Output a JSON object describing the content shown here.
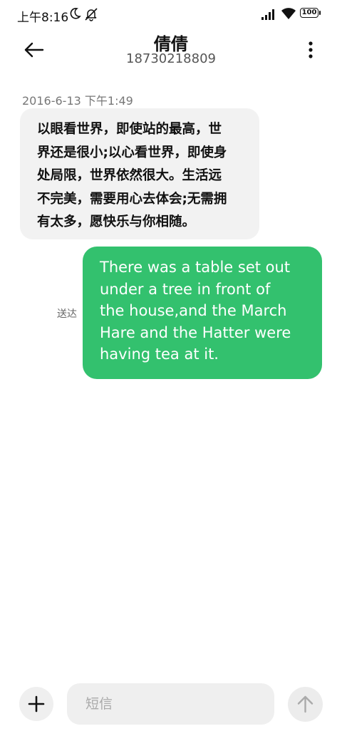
{
  "status_bar": {
    "time": "上午8:16",
    "battery": "100",
    "icons": [
      "moon-icon",
      "notifications-off-icon",
      "signal-icon",
      "wifi-icon",
      "battery-icon"
    ]
  },
  "header": {
    "contact_name": "倩倩",
    "contact_number": "18730218809",
    "back_icon": "arrow-left-icon",
    "more_icon": "more-vertical-icon"
  },
  "conversation": {
    "timestamp": "2016-6-13 下午1:49",
    "messages": [
      {
        "direction": "incoming",
        "lines": [
          "以眼看世界，即使站的最高，世",
          "界还是很小;以心看世界，即使身",
          "处局限，世界依然很大。生活远",
          "不完美，需要用心去体会;无需拥",
          "有太多，愿快乐与你相随。"
        ]
      },
      {
        "direction": "outgoing",
        "status": "送达",
        "lines": [
          "There was a table set out",
          "under a tree in front of",
          "the house,and the March",
          "Hare and the Hatter were",
          "having tea at it."
        ]
      }
    ]
  },
  "composer": {
    "placeholder": "短信",
    "value": "",
    "add_icon": "plus-icon",
    "send_icon": "arrow-up-icon"
  },
  "colors": {
    "outgoing_bubble": "#33c16e",
    "incoming_bubble": "#f2f2f2"
  }
}
